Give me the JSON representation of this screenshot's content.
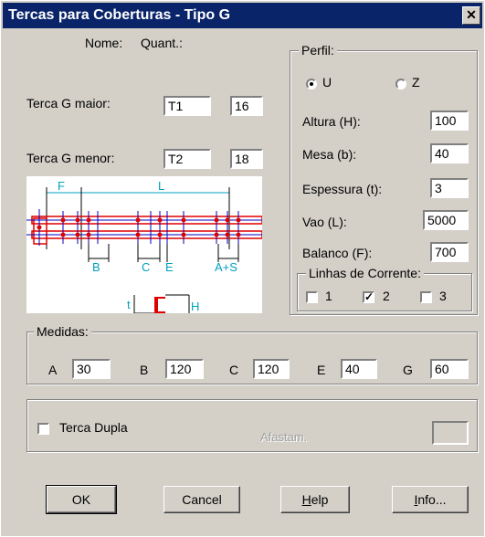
{
  "window": {
    "title": "Tercas para Coberturas - Tipo G",
    "close_glyph": "✕"
  },
  "headers": {
    "nome": "Nome:",
    "quant": "Quant.:"
  },
  "terca_maior": {
    "label": "Terca G maior:",
    "nome": "T1",
    "quant": "16"
  },
  "terca_menor": {
    "label": "Terca G menor:",
    "nome": "T2",
    "quant": "18"
  },
  "perfil": {
    "legend": "Perfil:",
    "options": [
      {
        "label": "U",
        "selected": true
      },
      {
        "label": "Z",
        "selected": false
      }
    ],
    "altura": {
      "label": "Altura (H):",
      "value": "100"
    },
    "mesa": {
      "label": "Mesa (b):",
      "value": "40"
    },
    "espessura": {
      "label": "Espessura (t):",
      "value": "3"
    },
    "vao": {
      "label": "Vao (L):",
      "value": "5000"
    },
    "balanco": {
      "label": "Balanco (F):",
      "value": "700"
    },
    "linhas": {
      "legend": "Linhas de Corrente:",
      "options": [
        {
          "label": "1",
          "checked": false
        },
        {
          "label": "2",
          "checked": true
        },
        {
          "label": "3",
          "checked": false
        }
      ]
    }
  },
  "diagram": {
    "labels": {
      "F": "F",
      "L": "L",
      "B": "B",
      "C": "C",
      "E": "E",
      "APlusS": "A+S",
      "t": "t",
      "H": "H"
    },
    "colors": {
      "beam": "#e00000",
      "axis": "#0000c0",
      "dim": "#00a0c0"
    }
  },
  "medidas": {
    "legend": "Medidas:",
    "items": [
      {
        "label": "A",
        "value": "30"
      },
      {
        "label": "B",
        "value": "120"
      },
      {
        "label": "C",
        "value": "120"
      },
      {
        "label": "E",
        "value": "40"
      },
      {
        "label": "G",
        "value": "60"
      }
    ]
  },
  "dupla": {
    "label": "Terca Dupla",
    "checked": false,
    "afastam_label": "Afastam.",
    "afastam_value": ""
  },
  "buttons": {
    "ok": "OK",
    "cancel": "Cancel",
    "help_h": "H",
    "help_rest": "elp",
    "info_i": "I",
    "info_rest": "nfo..."
  }
}
